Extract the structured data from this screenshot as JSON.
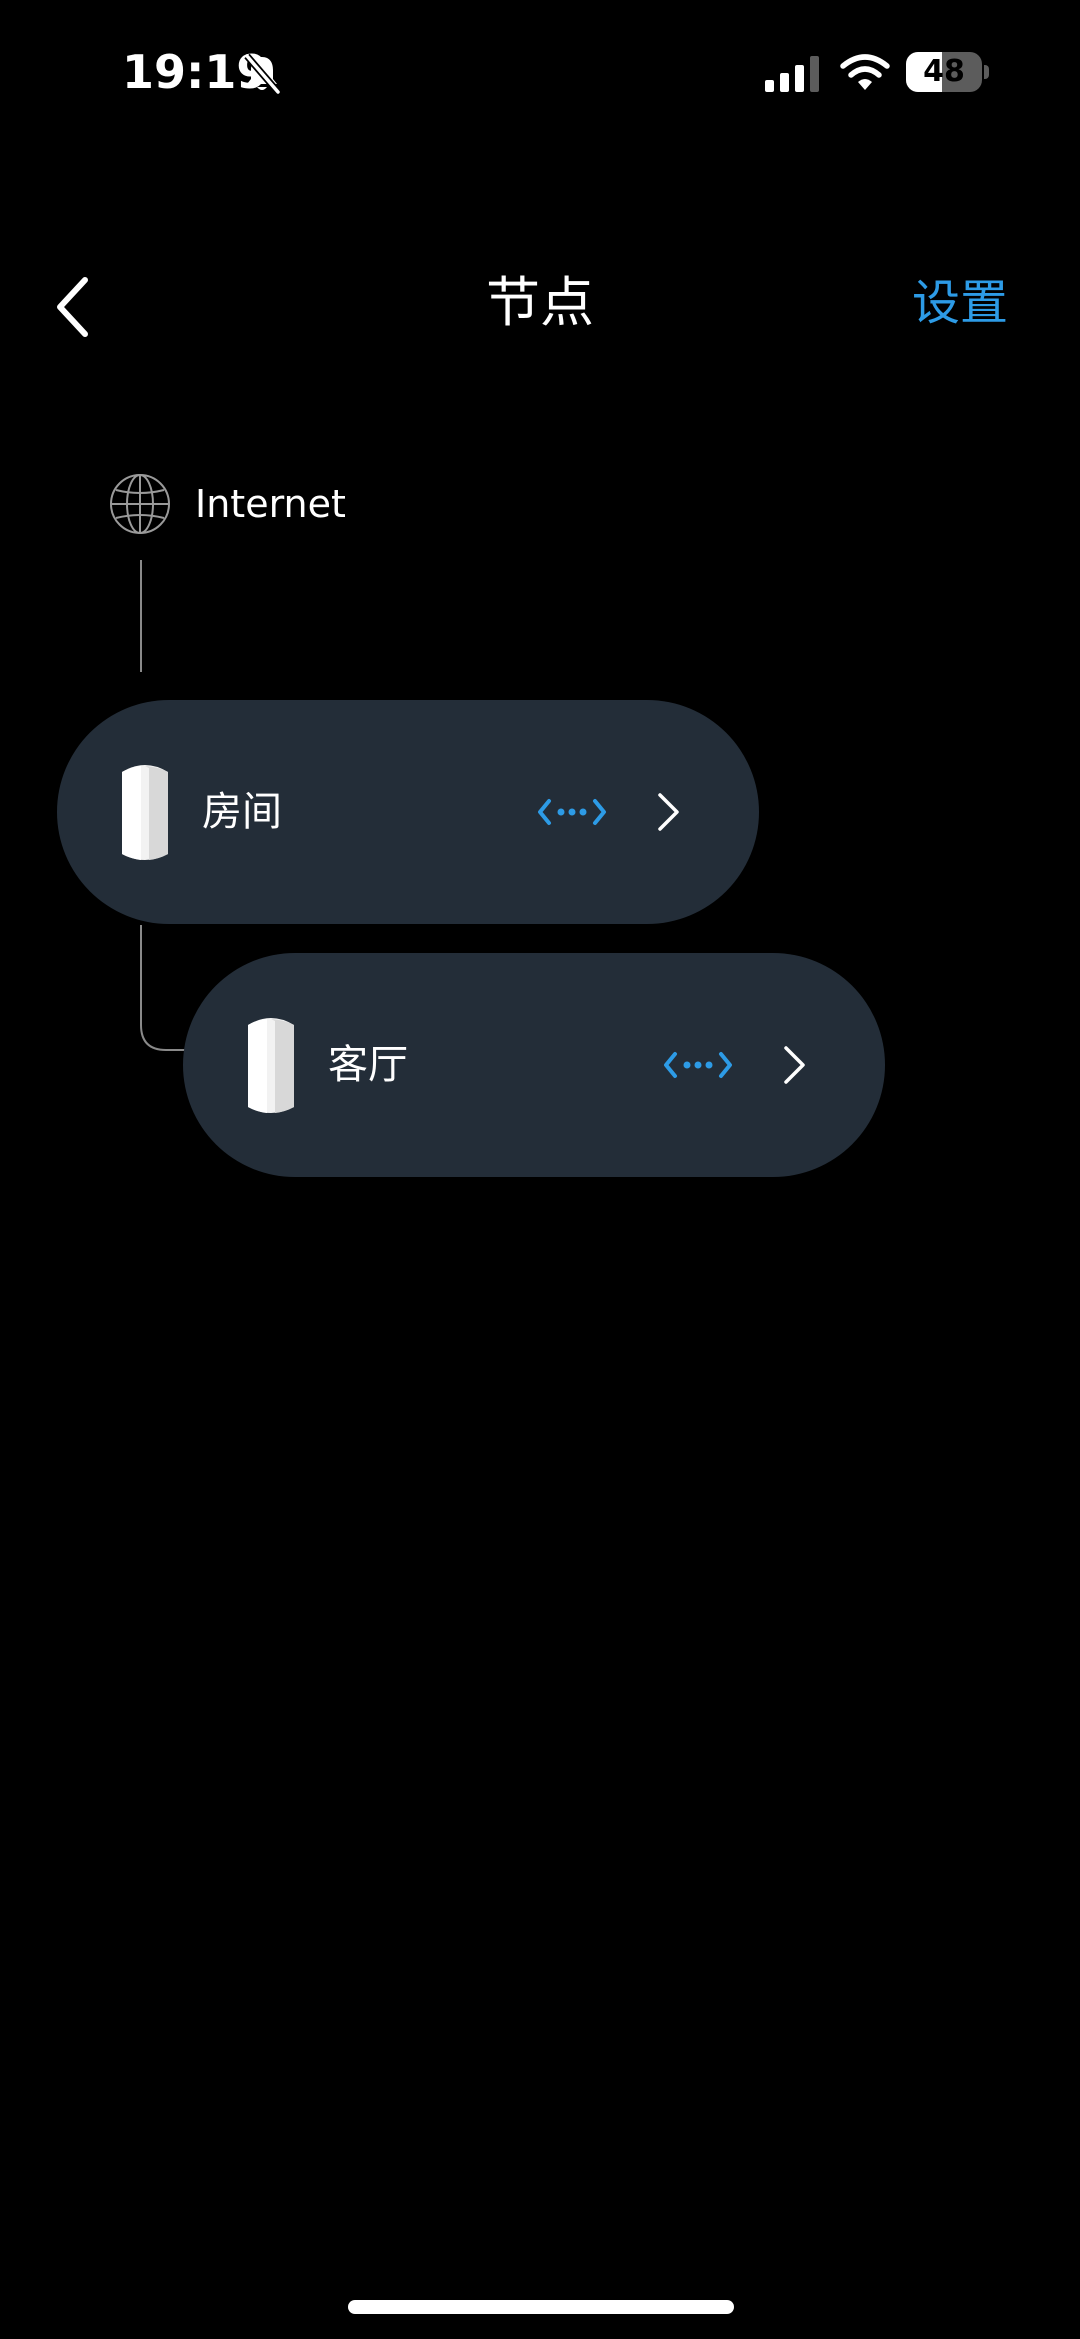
{
  "status_bar": {
    "time": "19:19",
    "battery": "48",
    "battery_level": 0.48,
    "icons": [
      "bell-slash-icon",
      "cellular-signal-icon",
      "wifi-icon",
      "battery-icon"
    ]
  },
  "nav": {
    "title": "节点",
    "back_icon": "chevron-left-icon",
    "settings_label": "设置"
  },
  "internet": {
    "icon": "globe-icon",
    "label": "Internet"
  },
  "nodes": [
    {
      "name": "房间",
      "icon": "router-node-icon",
      "status_icon": "connection-dots-icon"
    },
    {
      "name": "客厅",
      "icon": "router-node-icon",
      "status_icon": "connection-dots-icon"
    }
  ],
  "colors": {
    "background": "#000000",
    "card": "#232d38",
    "accent": "#2d9be6",
    "text": "#ffffff"
  }
}
